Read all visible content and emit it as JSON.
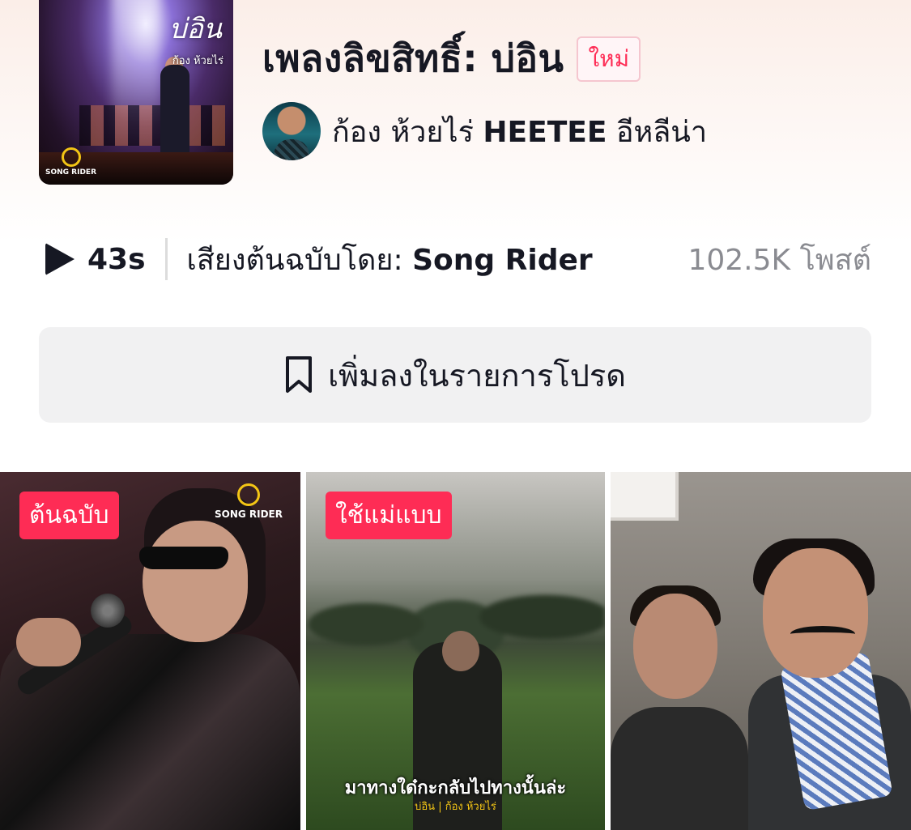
{
  "header": {
    "cover": {
      "script_title": "บ่อิน",
      "subtitle": "ก้อง ห้วยไร่",
      "logo_text": "SONG RIDER"
    },
    "title": "เพลงลิขสิทธิ์: บ่อิน",
    "new_badge": "ใหม่",
    "artist_1": "ก้อง ห้วยไร่",
    "artist_2": "HEETEE",
    "artist_3": "อีหลีน่า"
  },
  "meta": {
    "duration": "43s",
    "origin_label": "เสียงต้นฉบับโดย:",
    "origin_name": "Song Rider",
    "posts": "102.5K โพสต์"
  },
  "favorite": {
    "label": "เพิ่มลงในรายการโปรด",
    "icon": "bookmark-icon"
  },
  "videos": [
    {
      "tag": "ต้นฉบับ",
      "logo": "SONG RIDER"
    },
    {
      "tag": "ใช้แม่แบบ",
      "caption": "มาทางใด๋กะกลับไปทางนั้นล่ะ",
      "subcaption": "บ่อิน | ก้อง ห้วยไร่"
    },
    {
      "tag": ""
    }
  ],
  "colors": {
    "accent": "#fe2c55",
    "text": "#161823",
    "muted": "#8a8b91",
    "button_bg": "#f1f1f2"
  }
}
